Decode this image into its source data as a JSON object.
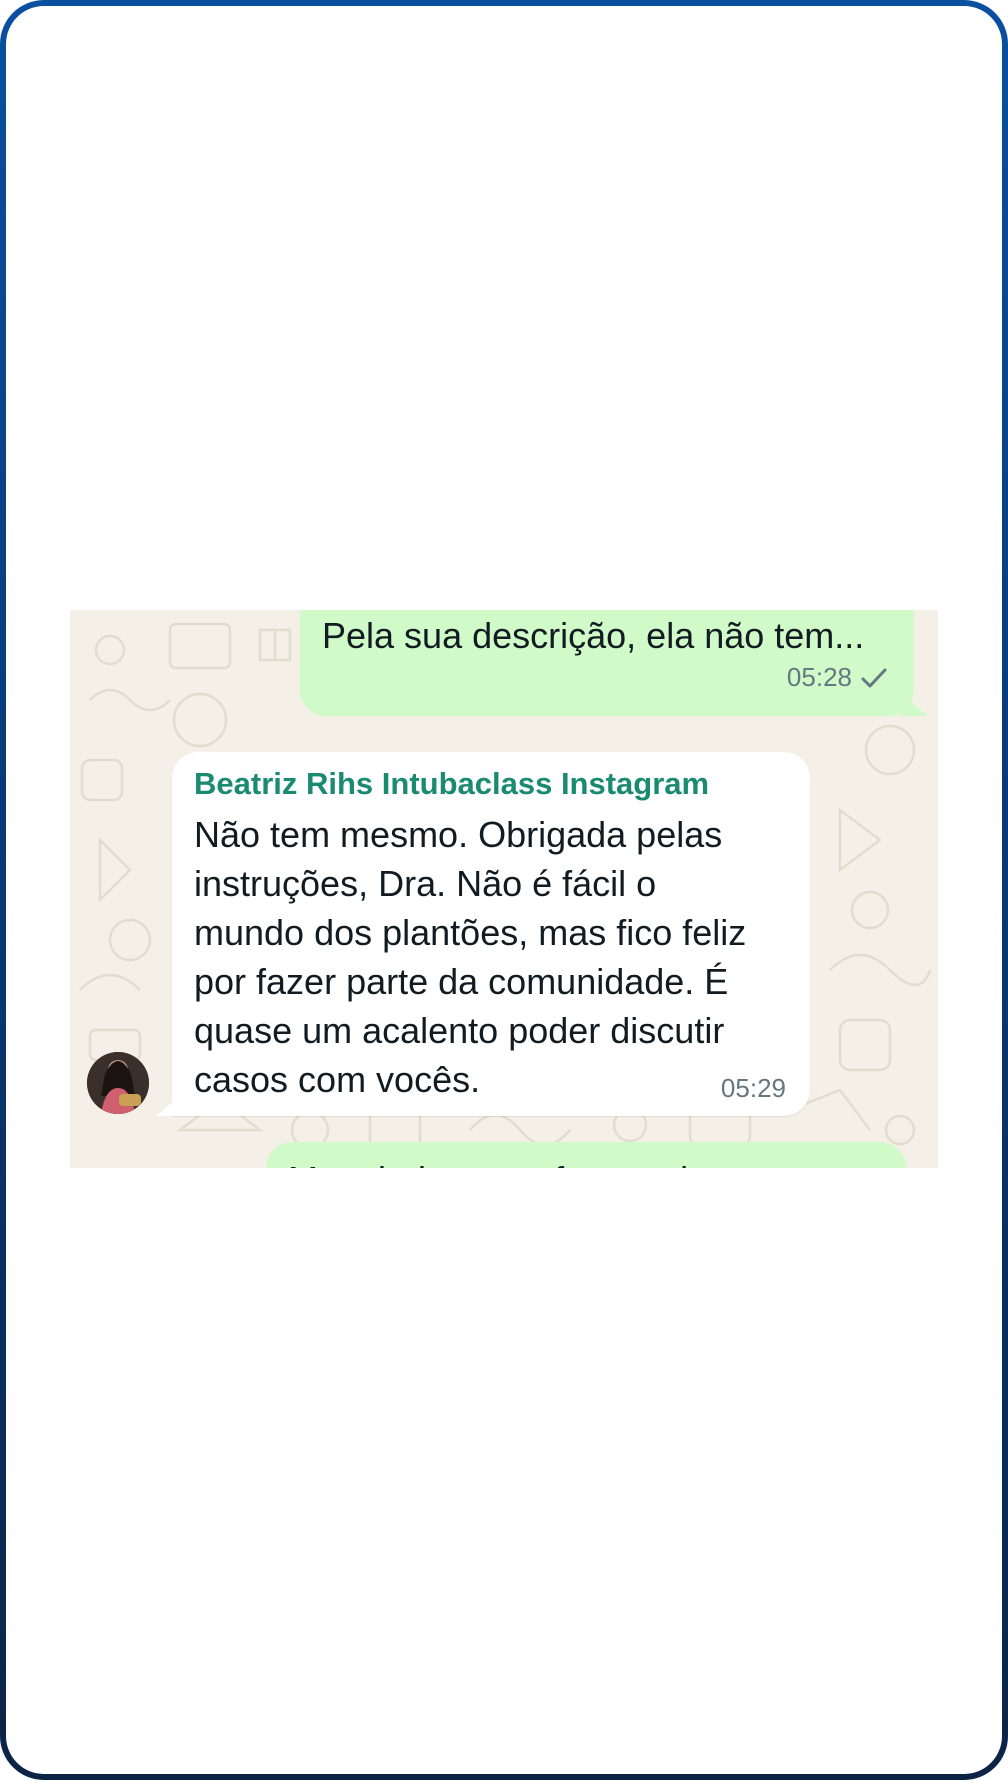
{
  "chat": {
    "messages": [
      {
        "direction": "outgoing",
        "text": "Pela sua descrição, ela não tem...",
        "time": "05:28",
        "status_icon": "single-check-icon"
      },
      {
        "direction": "incoming",
        "sender": "Beatriz Rihs Intubaclass Instagram",
        "lines": [
          "Não tem mesmo. Obrigada pelas",
          "instruções, Dra. Não é fácil o",
          "mundo dos plantões, mas fico feliz",
          "por fazer parte da comunidade. É",
          "quase um acalento poder discutir",
          "casos com vocês."
        ],
        "time": "05:29"
      },
      {
        "direction": "outgoing",
        "text": "Manejaria como fratura de arco"
      }
    ]
  },
  "colors": {
    "frame_top": "#0b4fa0",
    "frame_bottom": "#0b2446",
    "outgoing_bubble": "#d1fac9",
    "incoming_bubble": "#ffffff",
    "sender_name": "#1a8a70",
    "chat_background": "#f4efe7",
    "meta_text": "#667781"
  }
}
